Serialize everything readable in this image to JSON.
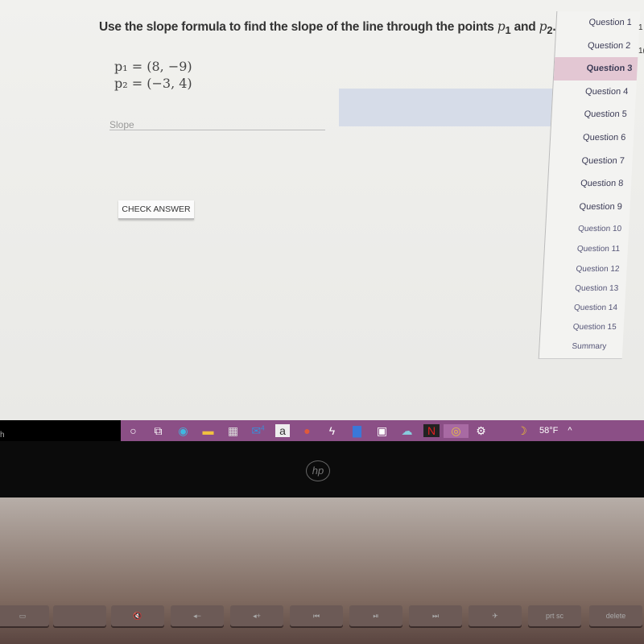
{
  "question": {
    "text": "Use the slope formula to find the slope of the line through the points",
    "p1": "p",
    "p1_sub": "1",
    "and": "and",
    "p2": "p",
    "p2_sub": "2",
    "end": "."
  },
  "points": {
    "p1": "p₁ = (8, −9)",
    "p2": "p₂ = (−3, 4)"
  },
  "slope_input": {
    "placeholder": "Slope",
    "value": ""
  },
  "check_button": "CHECK ANSWER",
  "nav": {
    "items": [
      "Question 1",
      "Question 2",
      "Question 3",
      "Question 4",
      "Question 5",
      "Question 6",
      "Question 7",
      "Question 8",
      "Question 9",
      "Question 10",
      "Question 11",
      "Question 12",
      "Question 13",
      "Question 14",
      "Question 15",
      "Summary"
    ],
    "active": "Question 3",
    "active_color": "#e3c7d3"
  },
  "side_clip": [
    "1",
    "1("
  ],
  "search_stub": "h",
  "taskbar": {
    "color": "#8b4f86",
    "mail_badge": "4",
    "weather": "58°F",
    "icons": [
      "cortana-icon",
      "task-view-icon",
      "edge-icon",
      "file-explorer-icon",
      "store-icon",
      "mail-icon",
      "amazon-icon",
      "powerpoint-icon",
      "app-icon",
      "word-icon",
      "anime-app-icon",
      "cloud-icon",
      "netflix-icon",
      "chrome-icon",
      "settings-icon"
    ]
  },
  "laptop": {
    "brand": "hp",
    "keys": [
      "prt sc",
      "delete"
    ]
  }
}
